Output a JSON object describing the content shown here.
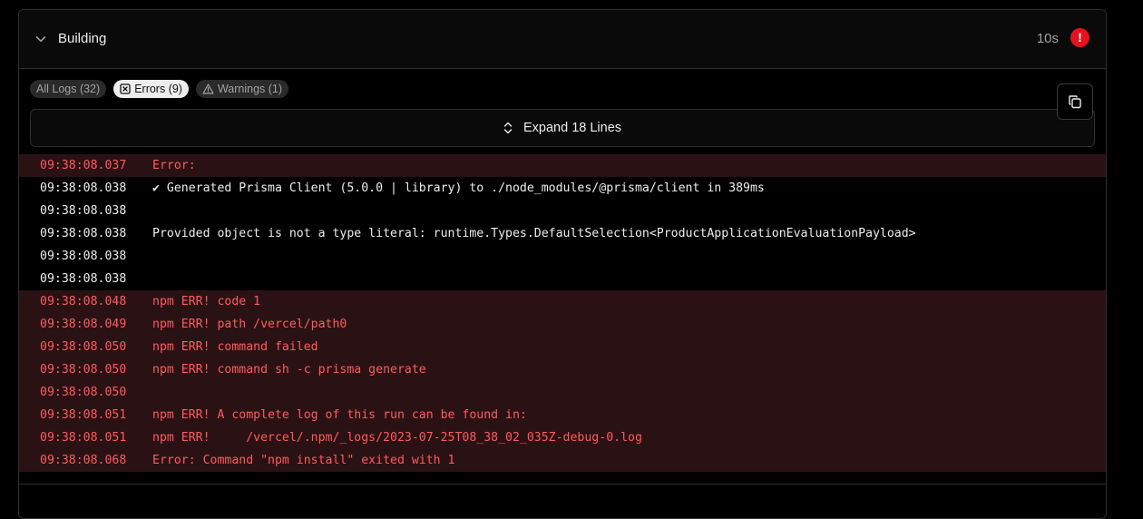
{
  "header": {
    "title": "Building",
    "duration": "10s",
    "alert_glyph": "!",
    "alert_color": "#e5121e"
  },
  "filters": [
    {
      "label": "All Logs (32)",
      "active": false
    },
    {
      "label": "Errors (9)",
      "active": true,
      "icon": "x-square-icon"
    },
    {
      "label": "Warnings (1)",
      "active": false,
      "icon": "warning-triangle-icon"
    }
  ],
  "expand": {
    "label": "Expand 18 Lines",
    "icon": "expand-vertical-icon"
  },
  "copy": {
    "icon": "copy-icon"
  },
  "logs": [
    {
      "time": "09:38:08.037",
      "msg": "Error:",
      "error": true
    },
    {
      "time": "09:38:08.038",
      "msg": "✔ Generated Prisma Client (5.0.0 | library) to ./node_modules/@prisma/client in 389ms",
      "error": false
    },
    {
      "time": "09:38:08.038",
      "msg": "",
      "error": false
    },
    {
      "time": "09:38:08.038",
      "msg": "Provided object is not a type literal: runtime.Types.DefaultSelection<ProductApplicationEvaluationPayload>",
      "error": false
    },
    {
      "time": "09:38:08.038",
      "msg": "",
      "error": false
    },
    {
      "time": "09:38:08.038",
      "msg": "",
      "error": false
    },
    {
      "time": "09:38:08.048",
      "msg": "npm ERR! code 1",
      "error": true
    },
    {
      "time": "09:38:08.049",
      "msg": "npm ERR! path /vercel/path0",
      "error": true
    },
    {
      "time": "09:38:08.050",
      "msg": "npm ERR! command failed",
      "error": true
    },
    {
      "time": "09:38:08.050",
      "msg": "npm ERR! command sh -c prisma generate",
      "error": true
    },
    {
      "time": "09:38:08.050",
      "msg": "",
      "error": true
    },
    {
      "time": "09:38:08.051",
      "msg": "npm ERR! A complete log of this run can be found in:",
      "error": true
    },
    {
      "time": "09:38:08.051",
      "msg": "npm ERR!     /vercel/.npm/_logs/2023-07-25T08_38_02_035Z-debug-0.log",
      "error": true
    },
    {
      "time": "09:38:08.068",
      "msg": "Error: Command \"npm install\" exited with 1",
      "error": true
    }
  ]
}
